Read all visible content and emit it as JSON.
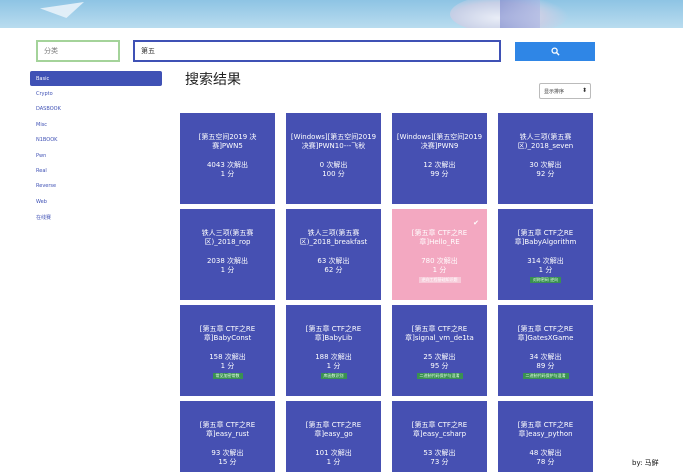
{
  "search": {
    "category_placeholder": "分类",
    "keyword_value": "第五",
    "button_icon": "search-icon"
  },
  "sidebar": {
    "items": [
      {
        "label": "Basic",
        "active": true
      },
      {
        "label": "Crypto",
        "active": false
      },
      {
        "label": "DASBOOK",
        "active": false
      },
      {
        "label": "Misc",
        "active": false
      },
      {
        "label": "N1BOOK",
        "active": false
      },
      {
        "label": "Pwn",
        "active": false
      },
      {
        "label": "Real",
        "active": false
      },
      {
        "label": "Reverse",
        "active": false
      },
      {
        "label": "Web",
        "active": false
      },
      {
        "label": "在线赛",
        "active": false
      }
    ]
  },
  "main": {
    "title": "搜索结果",
    "sort_label": "显示排序"
  },
  "cards": [
    {
      "title": "[第五空间2019 决赛]PWN5",
      "solves": "4043 次解出",
      "points": "1 分",
      "tag": "",
      "solved": false
    },
    {
      "title": "[Windows][第五空间2019 决赛]PWN10---飞秋",
      "solves": "0 次解出",
      "points": "100 分",
      "tag": "",
      "solved": false
    },
    {
      "title": "[Windows][第五空间2019 决赛]PWN9",
      "solves": "12 次解出",
      "points": "99 分",
      "tag": "",
      "solved": false
    },
    {
      "title": "铁人三项(第五赛区)_2018_seven",
      "solves": "30 次解出",
      "points": "92 分",
      "tag": "",
      "solved": false
    },
    {
      "title": "铁人三项(第五赛区)_2018_rop",
      "solves": "2038 次解出",
      "points": "1 分",
      "tag": "",
      "solved": false
    },
    {
      "title": "铁人三项(第五赛区)_2018_breakfast",
      "solves": "63 次解出",
      "points": "62 分",
      "tag": "",
      "solved": false
    },
    {
      "title": "[第五章 CTF之RE章]Hello_RE",
      "solves": "780 次解出",
      "points": "1 分",
      "tag": "逆向工程基础知识题",
      "solved": true
    },
    {
      "title": "[第五章 CTF之RE章]BabyAlgorithm",
      "solves": "314 次解出",
      "points": "1 分",
      "tag": "对称密码 逆向",
      "solved": false
    },
    {
      "title": "[第五章 CTF之RE章]BabyConst",
      "solves": "158 次解出",
      "points": "1 分",
      "tag": "常见加密常数",
      "solved": false
    },
    {
      "title": "[第五章 CTF之RE章]BabyLib",
      "solves": "188 次解出",
      "points": "1 分",
      "tag": "库函数识别",
      "solved": false
    },
    {
      "title": "[第五章 CTF之RE章]signal_vm_de1ta",
      "solves": "25 次解出",
      "points": "95 分",
      "tag": "二进制代码保护与混淆",
      "solved": false
    },
    {
      "title": "[第五章 CTF之RE章]GatesXGame",
      "solves": "34 次解出",
      "points": "89 分",
      "tag": "二进制代码保护与混淆",
      "solved": false
    },
    {
      "title": "[第五章 CTF之RE章]easy_rust",
      "solves": "93 次解出",
      "points": "15 分",
      "tag": "",
      "solved": false
    },
    {
      "title": "[第五章 CTF之RE章]easy_go",
      "solves": "101 次解出",
      "points": "1 分",
      "tag": "",
      "solved": false
    },
    {
      "title": "[第五章 CTF之RE章]easy_csharp",
      "solves": "53 次解出",
      "points": "73 分",
      "tag": "",
      "solved": false
    },
    {
      "title": "[第五章 CTF之RE章]easy_python",
      "solves": "48 次解出",
      "points": "78 分",
      "tag": "",
      "solved": false
    }
  ],
  "watermark": "by: 马鲜",
  "colors": {
    "accent": "#3f51b5",
    "card": "#4650b2",
    "card_solved": "#f3a8c1",
    "search_button": "#2f86e6",
    "tag": "#3a9152"
  }
}
